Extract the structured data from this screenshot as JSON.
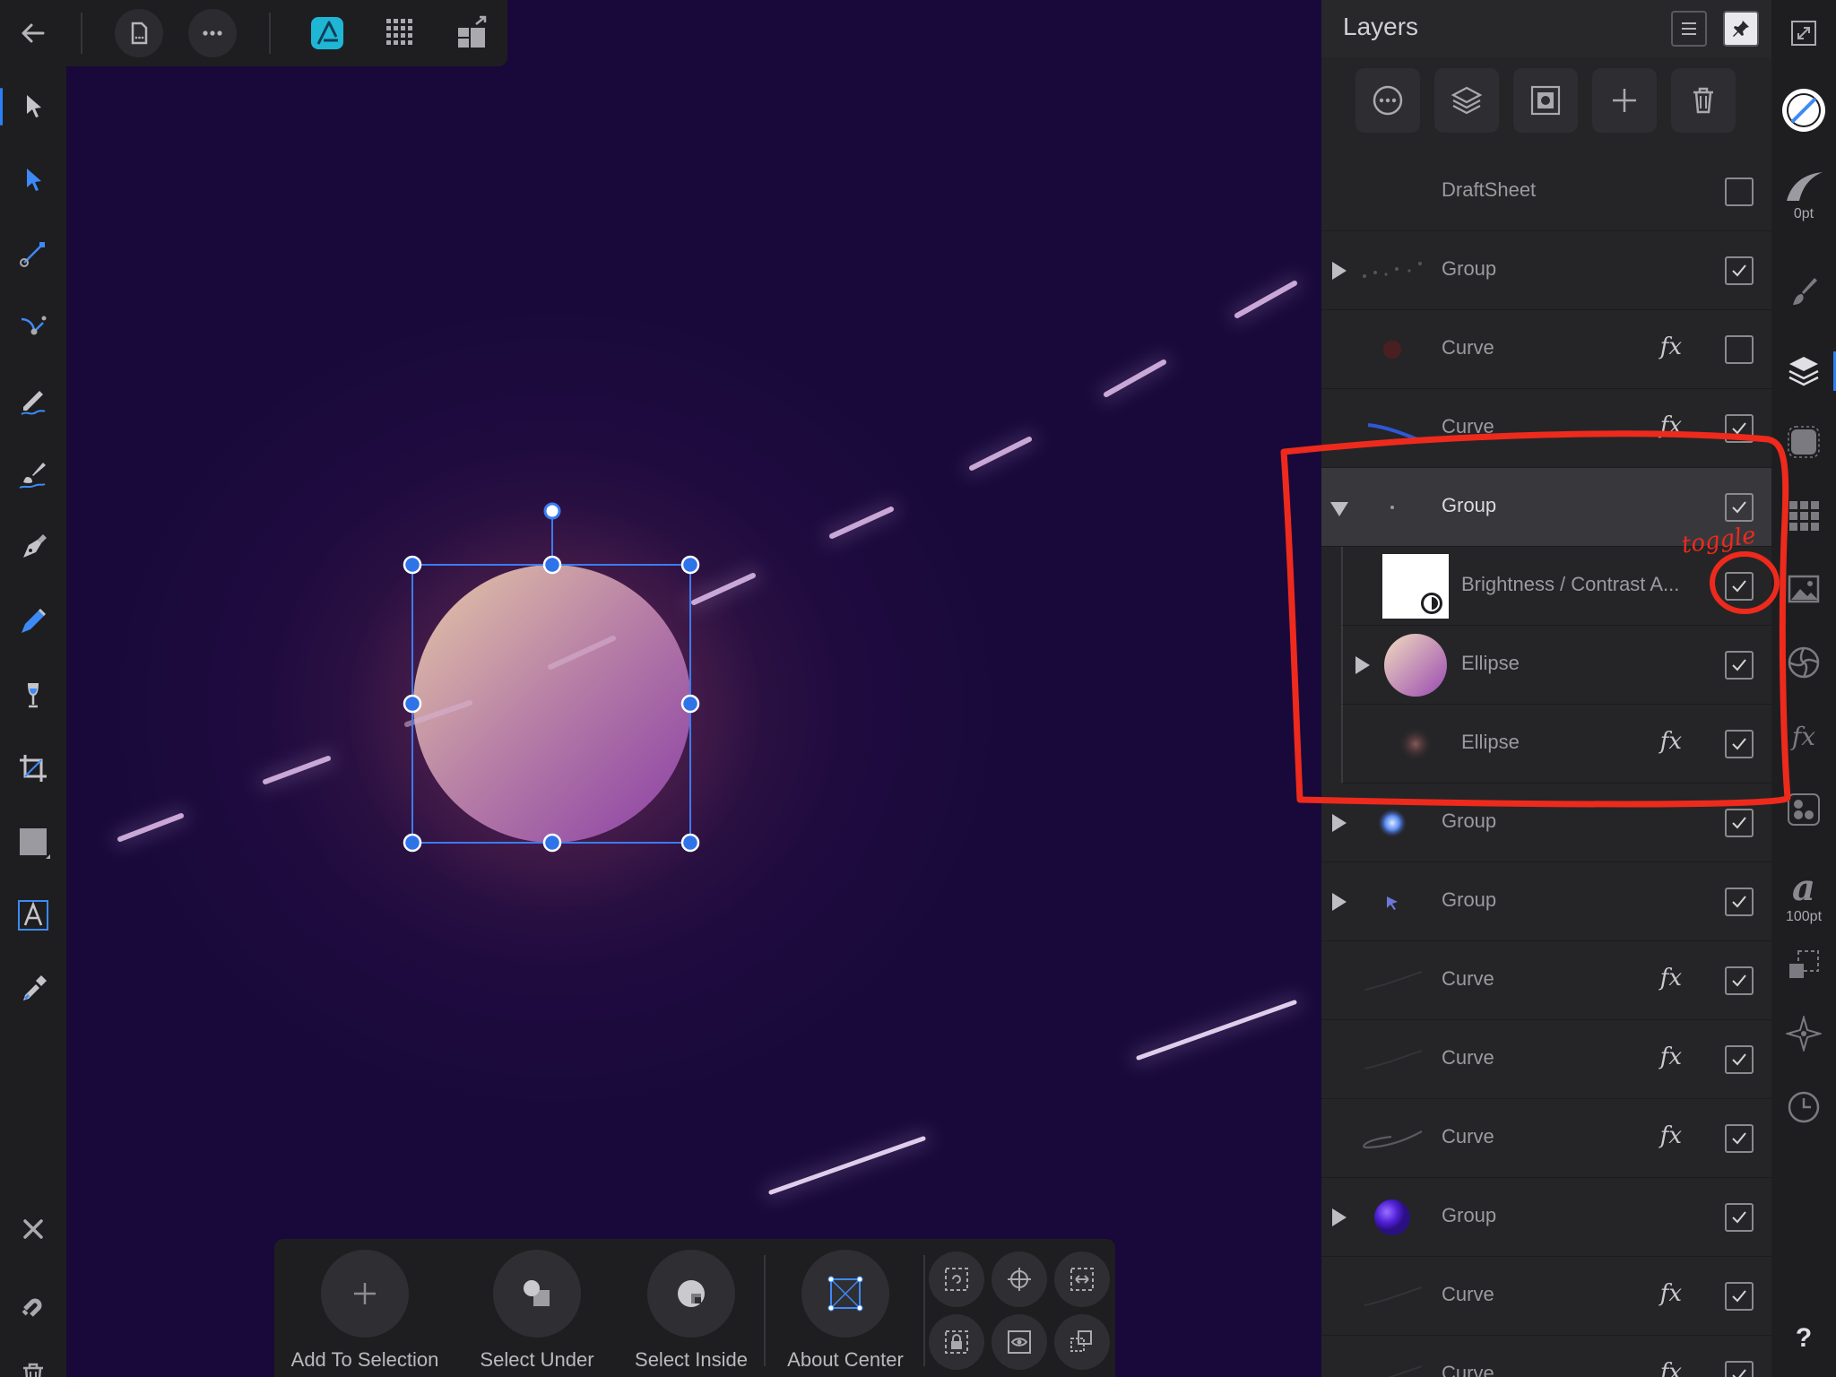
{
  "panel": {
    "title": "Layers"
  },
  "layers": [
    {
      "name": "DraftSheet",
      "fx": "",
      "checked": false,
      "expander": "none",
      "thumb": "none",
      "child": false,
      "selected": false
    },
    {
      "name": "Group",
      "fx": "",
      "checked": true,
      "expander": "closed",
      "thumb": "dots",
      "child": false,
      "selected": false
    },
    {
      "name": "Curve",
      "fx": "fx",
      "checked": false,
      "expander": "none",
      "thumb": "red-dot",
      "child": false,
      "selected": false
    },
    {
      "name": "Curve",
      "fx": "fx",
      "checked": true,
      "expander": "none",
      "thumb": "blue-streak",
      "child": false,
      "selected": false
    },
    {
      "name": "Group",
      "fx": "",
      "checked": true,
      "expander": "open",
      "thumb": "tiny-dot",
      "child": false,
      "selected": true
    },
    {
      "name": "Brightness / Contrast A...",
      "fx": "",
      "checked": true,
      "expander": "none",
      "thumb": "adjustment",
      "child": true,
      "selected": false
    },
    {
      "name": "Ellipse",
      "fx": "",
      "checked": true,
      "expander": "closed",
      "thumb": "gradient-ellipse",
      "child": true,
      "selected": false
    },
    {
      "name": "Ellipse",
      "fx": "fx",
      "checked": true,
      "expander": "none",
      "thumb": "glow",
      "child": true,
      "selected": false
    },
    {
      "name": "Group",
      "fx": "",
      "checked": true,
      "expander": "closed",
      "thumb": "blue-orb",
      "child": false,
      "selected": false
    },
    {
      "name": "Group",
      "fx": "",
      "checked": true,
      "expander": "closed",
      "thumb": "arrow",
      "child": false,
      "selected": false
    },
    {
      "name": "Curve",
      "fx": "fx",
      "checked": true,
      "expander": "none",
      "thumb": "faint-curve",
      "child": false,
      "selected": false
    },
    {
      "name": "Curve",
      "fx": "fx",
      "checked": true,
      "expander": "none",
      "thumb": "faint-curve",
      "child": false,
      "selected": false
    },
    {
      "name": "Curve",
      "fx": "fx",
      "checked": true,
      "expander": "none",
      "thumb": "curve",
      "child": false,
      "selected": false
    },
    {
      "name": "Group",
      "fx": "",
      "checked": true,
      "expander": "closed",
      "thumb": "purple-orb",
      "child": false,
      "selected": false
    },
    {
      "name": "Curve",
      "fx": "fx",
      "checked": true,
      "expander": "none",
      "thumb": "faint-curve",
      "child": false,
      "selected": false
    },
    {
      "name": "Curve",
      "fx": "fx",
      "checked": true,
      "expander": "none",
      "thumb": "faint-curve",
      "child": false,
      "selected": false
    }
  ],
  "context_bar": {
    "add_to_selection": "Add To Selection",
    "select_under": "Select Under",
    "select_inside": "Select Inside",
    "about_center": "About Center"
  },
  "right_toolbar": {
    "stroke_width": "0pt",
    "font_size": "100pt",
    "help": "?"
  },
  "annotation": {
    "note": "toggle",
    "color": "#ee2a1c"
  },
  "colors": {
    "accent": "#2d7ff9",
    "canvas_bg": "#1b0a3c",
    "panel_bg": "#252527",
    "toolbar_bg": "#1e1e20",
    "persona_cyan": "#1fb6d6"
  }
}
